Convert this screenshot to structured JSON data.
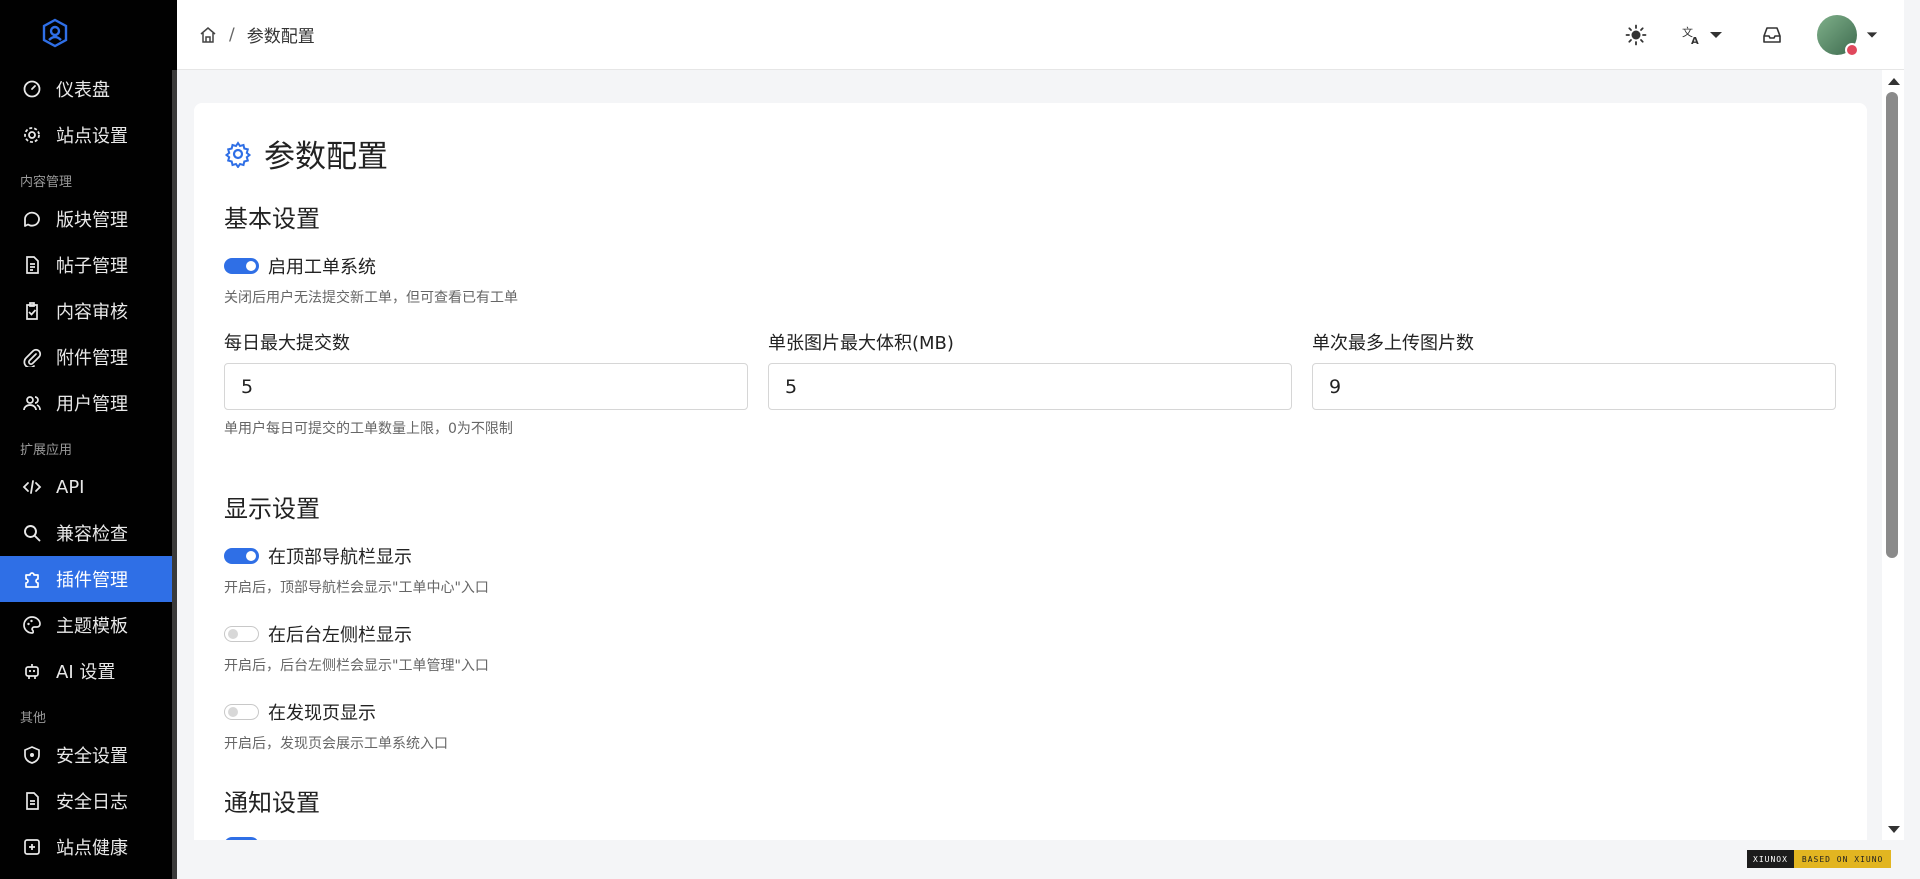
{
  "sidebar": {
    "items": [
      {
        "label": "仪表盘",
        "icon": "gauge-icon"
      },
      {
        "label": "站点设置",
        "icon": "gear-icon"
      },
      {
        "group": "内容管理"
      },
      {
        "label": "版块管理",
        "icon": "chat-bubble-icon"
      },
      {
        "label": "帖子管理",
        "icon": "document-icon"
      },
      {
        "label": "内容审核",
        "icon": "clipboard-check-icon"
      },
      {
        "label": "附件管理",
        "icon": "paperclip-icon"
      },
      {
        "label": "用户管理",
        "icon": "users-icon"
      },
      {
        "group": "扩展应用"
      },
      {
        "label": "API",
        "icon": "code-icon"
      },
      {
        "label": "兼容检查",
        "icon": "search-icon"
      },
      {
        "label": "插件管理",
        "icon": "puzzle-icon",
        "active": true
      },
      {
        "label": "主题模板",
        "icon": "palette-icon"
      },
      {
        "label": "AI 设置",
        "icon": "robot-icon"
      },
      {
        "group": "其他"
      },
      {
        "label": "安全设置",
        "icon": "shield-icon"
      },
      {
        "label": "安全日志",
        "icon": "log-icon"
      },
      {
        "label": "站点健康",
        "icon": "health-icon"
      }
    ]
  },
  "header": {
    "breadcrumb_sep": "/",
    "breadcrumb_current": "参数配置"
  },
  "page": {
    "title": "参数配置"
  },
  "basic": {
    "title": "基本设置",
    "enable_label": "启用工单系统",
    "enable_on": true,
    "enable_hint": "关闭后用户无法提交新工单，但可查看已有工单",
    "daily_max_label": "每日最大提交数",
    "daily_max_value": "5",
    "daily_max_hint": "单用户每日可提交的工单数量上限，0为不限制",
    "img_size_label": "单张图片最大体积(MB)",
    "img_size_value": "5",
    "img_count_label": "单次最多上传图片数",
    "img_count_value": "9"
  },
  "display": {
    "title": "显示设置",
    "topnav_label": "在顶部导航栏显示",
    "topnav_on": true,
    "topnav_hint": "开启后，顶部导航栏会显示\"工单中心\"入口",
    "sidebar_label": "在后台左侧栏显示",
    "sidebar_on": false,
    "sidebar_hint": "开启后，后台左侧栏会显示\"工单管理\"入口",
    "discover_label": "在发现页显示",
    "discover_on": false,
    "discover_hint": "开启后，发现页会展示工单系统入口"
  },
  "notify": {
    "title": "通知设置"
  },
  "footer": {
    "badge_left": "XIUNOX",
    "badge_right": "BASED ON XIUNO"
  },
  "colors": {
    "accent": "#2f6fe6",
    "sidebar_bg": "#010101"
  }
}
